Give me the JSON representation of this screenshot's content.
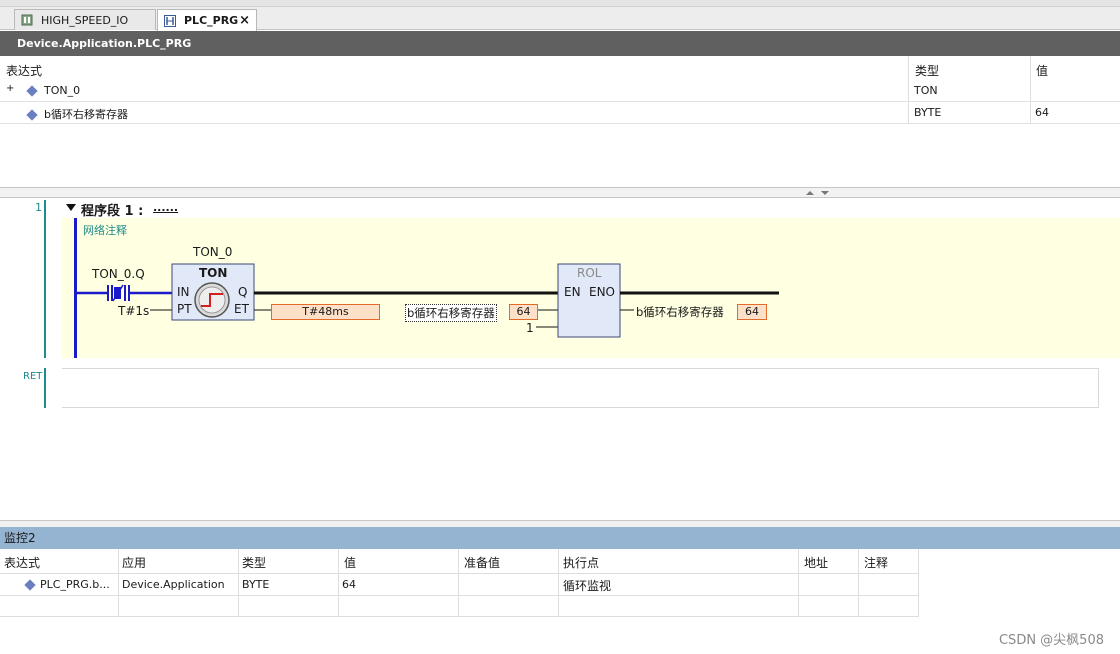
{
  "tabs": [
    {
      "label": "HIGH_SPEED_IO",
      "active": false
    },
    {
      "label": "PLC_PRG",
      "active": true,
      "close": "×"
    }
  ],
  "editor_title": "Device.Application.PLC_PRG",
  "declarations": {
    "headers": {
      "expression": "表达式",
      "type": "类型",
      "value": "值"
    },
    "rows": [
      {
        "expand": "+",
        "name": "TON_0",
        "type": "TON",
        "value": ""
      },
      {
        "expand": "",
        "name": "b循环右移寄存器",
        "type": "BYTE",
        "value": "64"
      }
    ]
  },
  "ladder": {
    "line_number": "1",
    "network_label": "程序段  1 :",
    "network_dots": "......",
    "network_comment": "网络注释",
    "ton": {
      "instance": "TON_0",
      "type": "TON",
      "pin_in": "IN",
      "pin_pt": "PT",
      "pin_q": "Q",
      "pin_et": "ET",
      "contact_var": "TON_0.Q",
      "pt_value": "T#1s",
      "et_value": "T#48ms"
    },
    "rol": {
      "title": "ROL",
      "pin_en": "EN",
      "pin_eno": "ENO",
      "in_var": "b循环右移寄存器",
      "in_value": "64",
      "in2_value": "1",
      "out_var": "b循环右移寄存器",
      "out_value": "64"
    },
    "ret_label": "RET"
  },
  "watch": {
    "title": "监控2",
    "headers": [
      "表达式",
      "应用",
      "类型",
      "值",
      "准备值",
      "执行点",
      "地址",
      "注释"
    ],
    "rows": [
      {
        "expression": "PLC_PRG.b...",
        "application": "Device.Application",
        "type": "BYTE",
        "value": "64",
        "prepared": "",
        "exec_point": "循环监视",
        "address": "",
        "comment": ""
      }
    ]
  },
  "watermark": "CSDN @尖枫508",
  "colors": {
    "title_bar": "#606060",
    "network_bg": "#ffffe1",
    "rail": "#1a1ac8",
    "watch_title": "#94b4d2",
    "online_value_bg": "#fce0c8",
    "online_value_border": "#e26a2a"
  }
}
